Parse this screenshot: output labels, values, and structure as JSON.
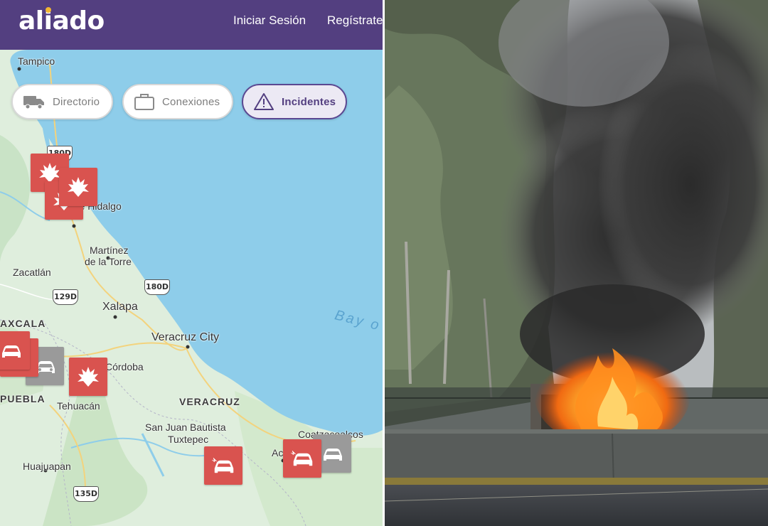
{
  "header": {
    "logo_text": "aliado",
    "login_label": "Iniciar Sesión",
    "register_label": "Regístrate"
  },
  "filters": {
    "directory_label": "Directorio",
    "connections_label": "Conexiones",
    "incidents_label": "Incidentes",
    "active": "Incidentes"
  },
  "map": {
    "cities": {
      "tampico": "Tampico",
      "poza_rica": "ica de Hidalgo",
      "martinez_1": "Martínez",
      "martinez_2": "de la Torre",
      "zacatlan": "Zacatlán",
      "xalapa": "Xalapa",
      "veracruz_city": "Veracruz City",
      "cordoba": "Córdoba",
      "tehuacan": "Tehuacán",
      "san_juan_1": "San Juan Bautista",
      "san_juan_2": "Tuxtepec",
      "huajuapan": "Huajuapan",
      "coatzacoalcos": "Coatzacoalcos",
      "acayucan": "Ac"
    },
    "states": {
      "tlaxcala": "AXCALA",
      "puebla": "PUEBLA",
      "veracruz": "VERACRUZ"
    },
    "sea": "Bay o",
    "highways": [
      "180D",
      "129D",
      "180D",
      "135D"
    ]
  },
  "markers": [
    {
      "type": "fire-icon",
      "color": "red"
    },
    {
      "type": "fire-icon",
      "color": "red"
    },
    {
      "type": "fire-icon",
      "color": "red"
    },
    {
      "type": "car-crash-icon",
      "color": "red"
    },
    {
      "type": "car-crash-icon",
      "color": "red"
    },
    {
      "type": "car-crash-icon",
      "color": "gray"
    },
    {
      "type": "fire-icon",
      "color": "red"
    },
    {
      "type": "car-crash-icon",
      "color": "red"
    },
    {
      "type": "car-crash-icon",
      "color": "red"
    },
    {
      "type": "car-crash-icon",
      "color": "gray"
    }
  ],
  "colors": {
    "header_bg": "#533f80",
    "logo_dot": "#f2b632",
    "incident_red": "#d9534f",
    "incident_gray": "#9a9a9a",
    "sea": "#8ecdea",
    "land": "#d7ecd8"
  },
  "photo": {
    "description_icon": "burning-truck-photo"
  }
}
